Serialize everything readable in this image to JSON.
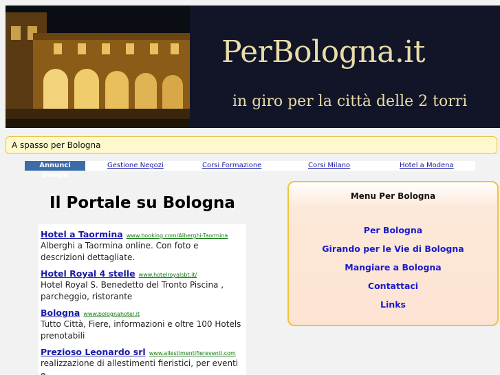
{
  "header": {
    "title": "PerBologna.it",
    "subtitle": "in giro per la città delle 2 torri"
  },
  "breadcrumb": {
    "text": "A spasso per Bologna"
  },
  "ad_links": {
    "label": "Annunci Google",
    "items": [
      {
        "label": "Gestione Negozi"
      },
      {
        "label": "Corsi Formazione"
      },
      {
        "label": "Corsi Milano"
      },
      {
        "label": "Hotel a Modena"
      }
    ]
  },
  "main": {
    "title": "Il Portale su Bologna",
    "ads": [
      {
        "title": "Hotel a Taormina",
        "url": "www.booking.com/Alberghi-Taormina",
        "desc": "Alberghi a Taormina online. Con foto e descrizioni dettagliate."
      },
      {
        "title": "Hotel Royal 4 stelle",
        "url": "www.hotelroyalsbt.it/",
        "desc": "Hotel Royal S. Benedetto del Tronto Piscina , parcheggio, ristorante"
      },
      {
        "title": "Bologna",
        "url": "www.bolognahotel.it",
        "desc": "Tutto Città, Fiere, informazioni e oltre 100 Hotels prenotabili"
      },
      {
        "title": "Prezioso Leonardo srl",
        "url": "www.allestimentifiereventi.com",
        "desc": "realizzazione di allestimenti fieristici, per eventi e"
      }
    ]
  },
  "menu": {
    "title": "Menu Per Bologna",
    "items": [
      {
        "label": "Per Bologna"
      },
      {
        "label": "Girando per le Vie di Bologna"
      },
      {
        "label": "Mangiare a Bologna"
      },
      {
        "label": "Contattaci"
      },
      {
        "label": "Links"
      }
    ]
  }
}
